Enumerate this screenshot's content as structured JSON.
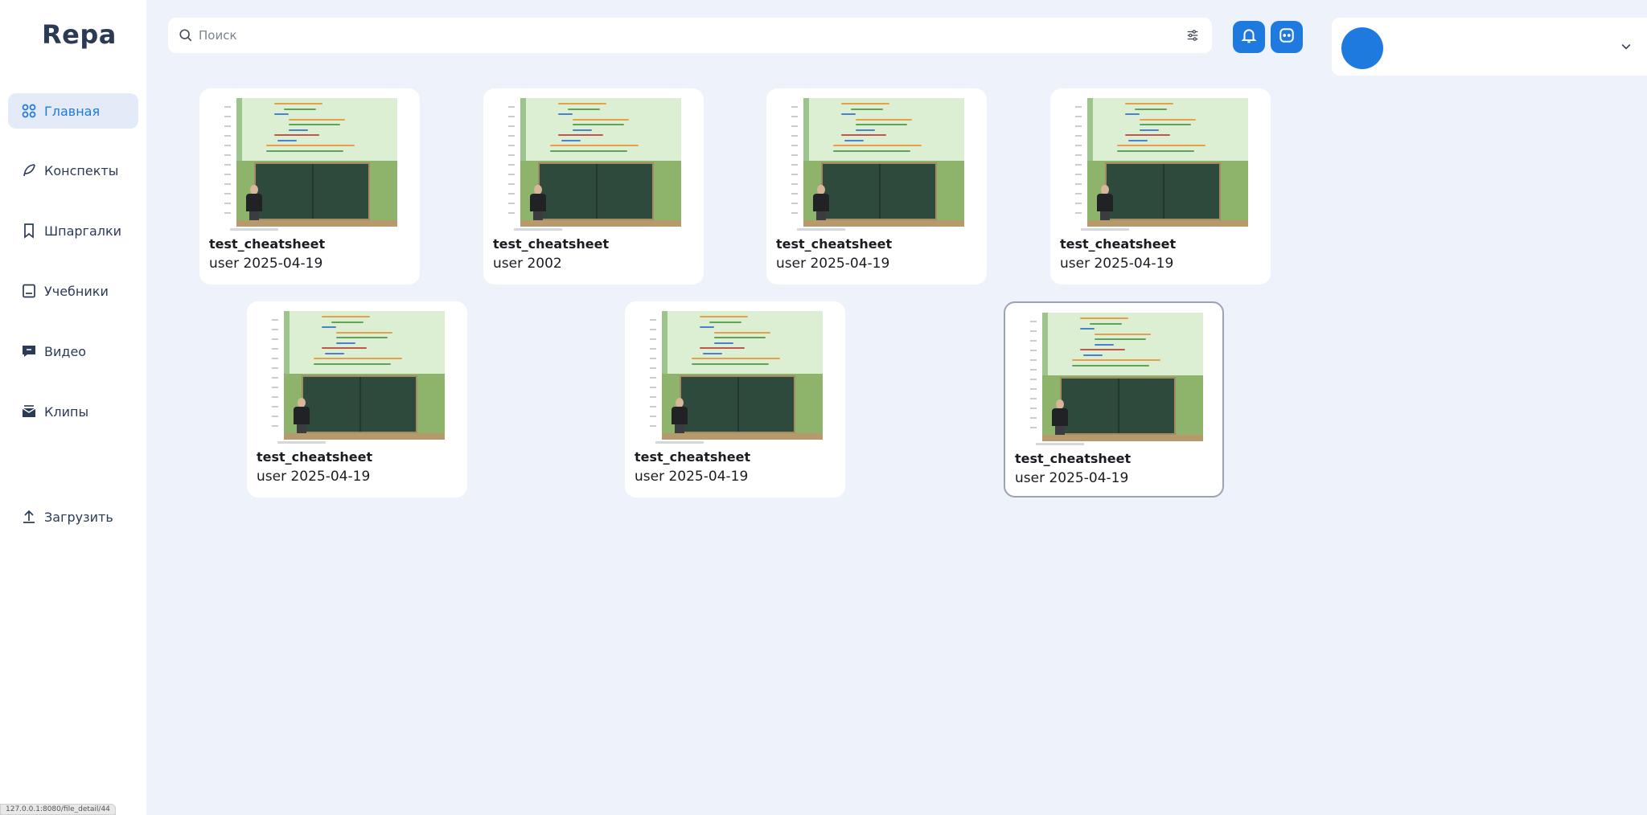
{
  "app": {
    "logo": "Repa"
  },
  "sidebar": {
    "items": [
      {
        "label": "Главная",
        "icon": "grid-icon",
        "active": true
      },
      {
        "label": "Конспекты",
        "icon": "feather-icon",
        "active": false
      },
      {
        "label": "Шпаргалки",
        "icon": "bookmark-icon",
        "active": false
      },
      {
        "label": "Учебники",
        "icon": "book-icon",
        "active": false
      },
      {
        "label": "Видео",
        "icon": "video-icon",
        "active": false
      },
      {
        "label": "Клипы",
        "icon": "clips-icon",
        "active": false
      }
    ],
    "upload": {
      "label": "Загрузить",
      "icon": "upload-icon"
    },
    "status_url": "127.0.0.1:8080/file_detail/44"
  },
  "search": {
    "placeholder": "Поиск",
    "value": ""
  },
  "colors": {
    "accent": "#1f7ae0",
    "background": "#eef3fb",
    "active_nav": "#e4ebf8"
  },
  "cards": [
    {
      "title": "test_cheatsheet",
      "meta": "user 2025-04-19"
    },
    {
      "title": "test_cheatsheet",
      "meta": "user 2002"
    },
    {
      "title": "test_cheatsheet",
      "meta": "user 2025-04-19"
    },
    {
      "title": "test_cheatsheet",
      "meta": "user 2025-04-19"
    },
    {
      "title": "test_cheatsheet",
      "meta": "user 2025-04-19"
    },
    {
      "title": "test_cheatsheet",
      "meta": "user 2025-04-19"
    },
    {
      "title": "test_cheatsheet",
      "meta": "user 2025-04-19",
      "selected": true
    }
  ]
}
